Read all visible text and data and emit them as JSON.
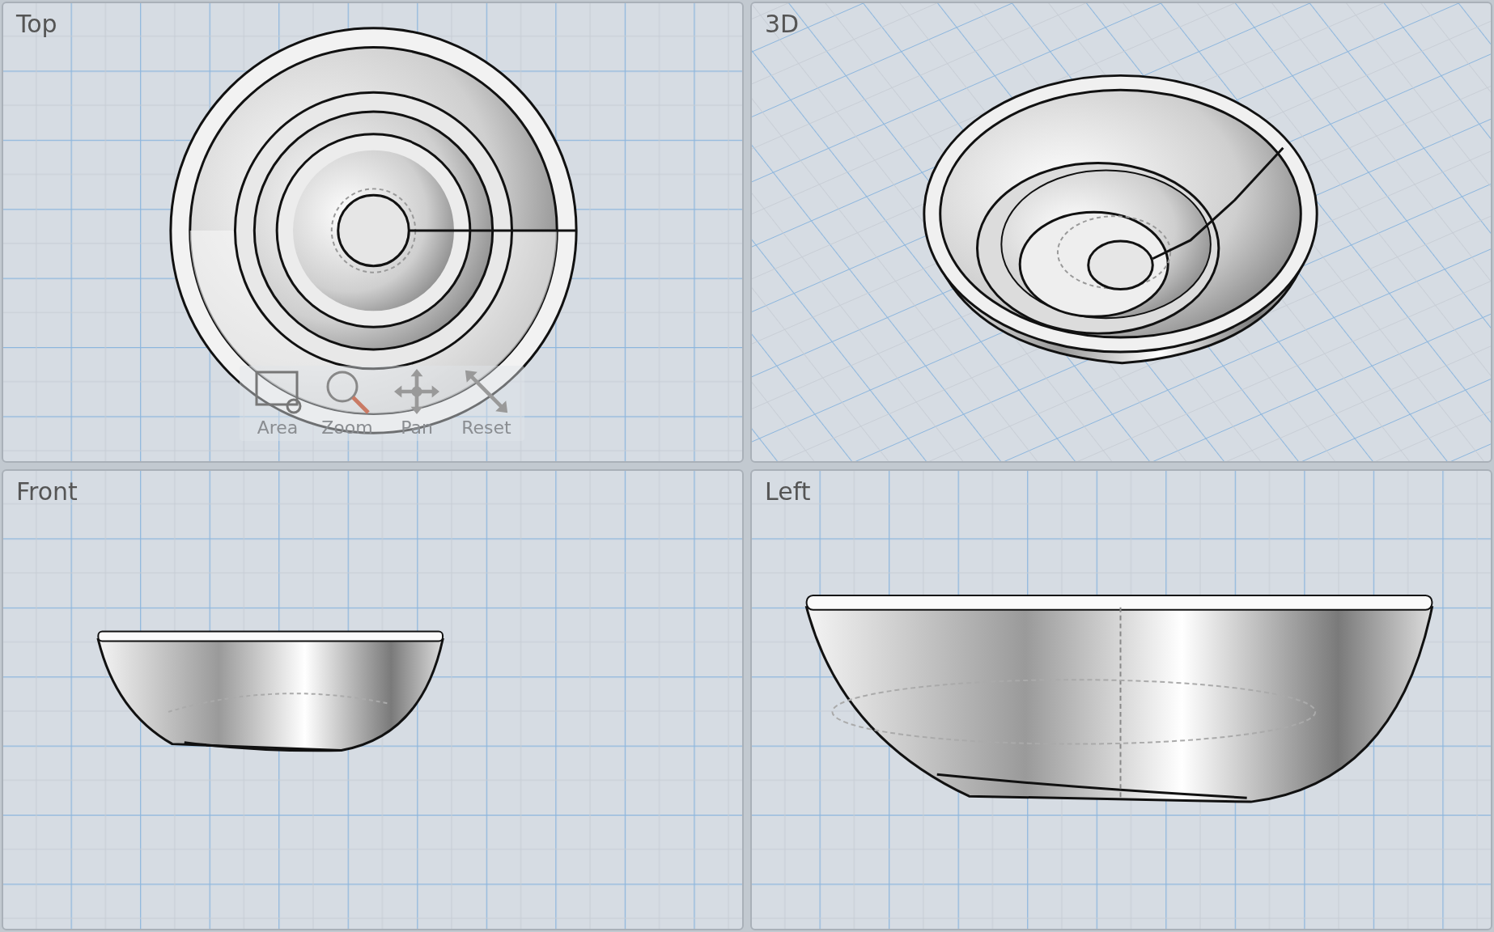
{
  "viewports": [
    {
      "label": "Top",
      "kind": "top"
    },
    {
      "label": "3D",
      "kind": "perspective"
    },
    {
      "label": "Front",
      "kind": "front"
    },
    {
      "label": "Left",
      "kind": "left"
    }
  ],
  "toolbar": {
    "buttons": [
      {
        "label": "Area",
        "kind": "area"
      },
      {
        "label": "Zoom",
        "kind": "zoom"
      },
      {
        "label": "Pan",
        "kind": "pan"
      },
      {
        "label": "Reset",
        "kind": "reset"
      }
    ]
  }
}
